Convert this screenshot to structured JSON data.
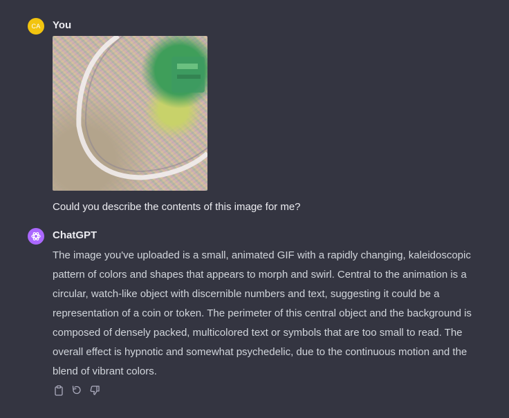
{
  "conversation": {
    "user_message": {
      "avatar_initials": "CA",
      "author": "You",
      "text": "Could you describe the contents of this image for me?"
    },
    "assistant_message": {
      "author": "ChatGPT",
      "text": "The image you've uploaded is a small, animated GIF with a rapidly changing, kaleidoscopic pattern of colors and shapes that appears to morph and swirl. Central to the animation is a circular, watch-like object with discernible numbers and text, suggesting it could be a representation of a coin or token. The perimeter of this central object and the background is composed of densely packed, multicolored text or symbols that are too small to read. The overall effect is hypnotic and somewhat psychedelic, due to the continuous motion and the blend of vibrant colors.",
      "actions": [
        "copy-icon",
        "regenerate-icon",
        "thumbs-down-icon"
      ]
    }
  },
  "colors": {
    "background": "#343541",
    "user_avatar": "#f2c40f",
    "assistant_avatar": "#ab68ff",
    "primary_text": "#ececf1",
    "secondary_text": "#d1d5db",
    "icon": "#acacbe"
  }
}
